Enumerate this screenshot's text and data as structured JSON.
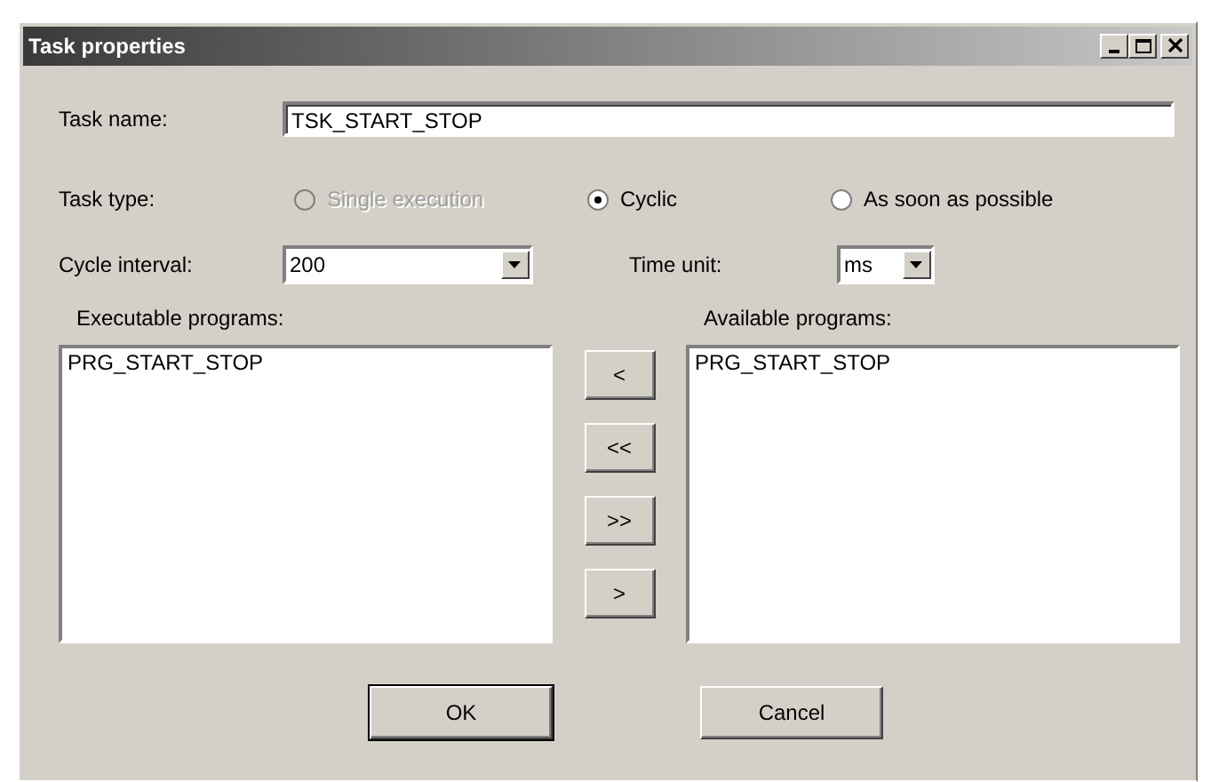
{
  "window": {
    "title": "Task properties"
  },
  "task_name": {
    "label": "Task name:",
    "value": "TSK_START_STOP"
  },
  "task_type": {
    "label": "Task type:",
    "options": [
      {
        "label": "Single execution",
        "selected": false,
        "disabled": true
      },
      {
        "label": "Cyclic",
        "selected": true,
        "disabled": false
      },
      {
        "label": "As soon as possible",
        "selected": false,
        "disabled": false
      }
    ]
  },
  "cycle_interval": {
    "label": "Cycle interval:",
    "value": "200"
  },
  "time_unit": {
    "label": "Time unit:",
    "value": "ms"
  },
  "executable_programs": {
    "label": "Executable programs:",
    "items": [
      "PRG_START_STOP"
    ]
  },
  "available_programs": {
    "label": "Available programs:",
    "items": [
      "PRG_START_STOP"
    ]
  },
  "move_buttons": [
    "<",
    "<<",
    ">>",
    ">"
  ],
  "buttons": [
    {
      "label": "OK",
      "default": true
    },
    {
      "label": "Cancel",
      "default": false
    }
  ]
}
